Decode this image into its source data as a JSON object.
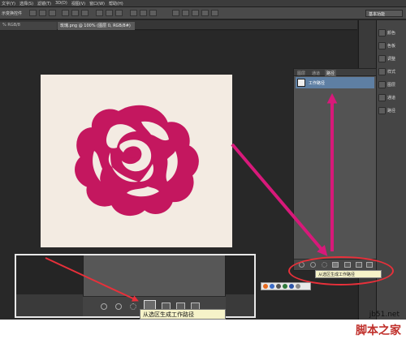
{
  "menu": {
    "items": [
      "文字(Y)",
      "选择(S)",
      "滤镜(T)",
      "3D(D)",
      "视图(V)",
      "窗口(W)",
      "帮助(H)"
    ]
  },
  "options_bar": {
    "label": "示变换控件",
    "workspace": "基本功能"
  },
  "tabs": {
    "tab1": "% RGB/8",
    "tab2": "玫瑰.png @ 100% (图层 0, RGB/8#)"
  },
  "paths_panel": {
    "tabs": [
      "图层",
      "通道",
      "路径"
    ],
    "active_tab": "路径",
    "path_name": "工作路径"
  },
  "right_panel": {
    "items": [
      "颜色",
      "色板",
      "调整",
      "样式",
      "图层",
      "通道",
      "路径"
    ]
  },
  "tooltip": {
    "small": "从选区生成工作路径",
    "large": "从选区生成工作路径"
  },
  "watermark": {
    "url": "jb51.net",
    "brand": "脚本之家"
  },
  "colors": {
    "arrow": "#d8197a",
    "rose": "#c4175f",
    "ellipse": "#e8303a",
    "selection": "#5e7fa3"
  }
}
